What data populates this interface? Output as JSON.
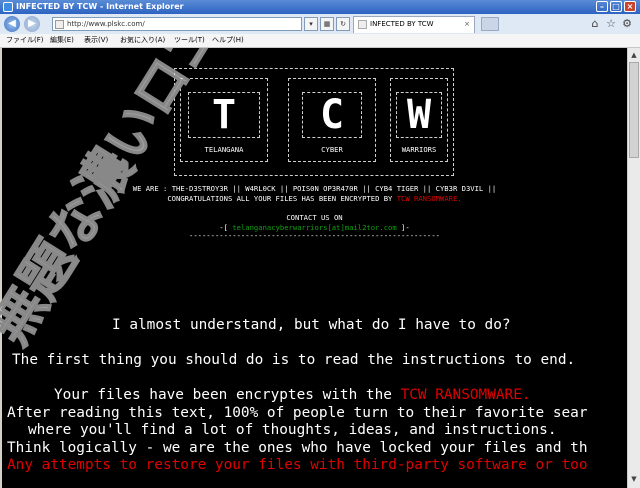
{
  "window": {
    "title": "INFECTED BY TCW - Internet Explorer",
    "minimize": "–",
    "maximize": "□",
    "close": "×"
  },
  "address": {
    "url": "http://www.plskc.com/",
    "dropdown": "▾",
    "refresh": "↻"
  },
  "tab": {
    "label": "INFECTED BY TCW",
    "close": "×"
  },
  "toolbar_icons": [
    "home-icon",
    "star-icon",
    "gear-icon"
  ],
  "menu": {
    "file": "ファイル(F)",
    "edit": "編集(E)",
    "view": "表示(V)",
    "favorites": "お気に入り(A)",
    "tools": "ツール(T)",
    "help": "ヘルプ(H)"
  },
  "banner": {
    "letters": [
      "T",
      "C",
      "W"
    ],
    "words": [
      "TELANGANA",
      "CYBER",
      "WARRIORS"
    ],
    "we_are": "WE ARE : THE-D3STROY3R || W4RL0CK || POIS0N OP3R470R || CYB4 TIGER || CYB3R D3VIL ||",
    "congrats_prefix": "CONGRATULATIONS ALL YOUR FILES HAS BEEN ENCRYPTED BY",
    "congrats_ransomware": "TCW RANSOMWARE.",
    "contact": "CONTACT US ON",
    "email_left": "-[",
    "email": "telanganacyberwarriors[at]mail2tor.com",
    "email_right": "]-",
    "dashes": "----------------------------------------------------------"
  },
  "message": {
    "line1": "I almost understand, but what do I have to do?",
    "line2": "The first thing you should do is to read the instructions to end.",
    "line3_prefix": "Your files have been encryptes with the",
    "line3_red": "TCW RANSOMWARE.",
    "line4": "After reading this text, 100% of people turn to their favorite sear",
    "line5": "where you'll find a lot of thoughts, ideas, and instructions.",
    "line6": "Think logically - we are the ones who have locked your files and th",
    "line7": "Any attempts to restore your files with third-party software or too"
  },
  "watermark": "無題な濃いロゴ",
  "colors": {
    "background": "#000000",
    "text": "#ffffff",
    "accent_red": "#e00000",
    "email_green": "#12a012"
  }
}
